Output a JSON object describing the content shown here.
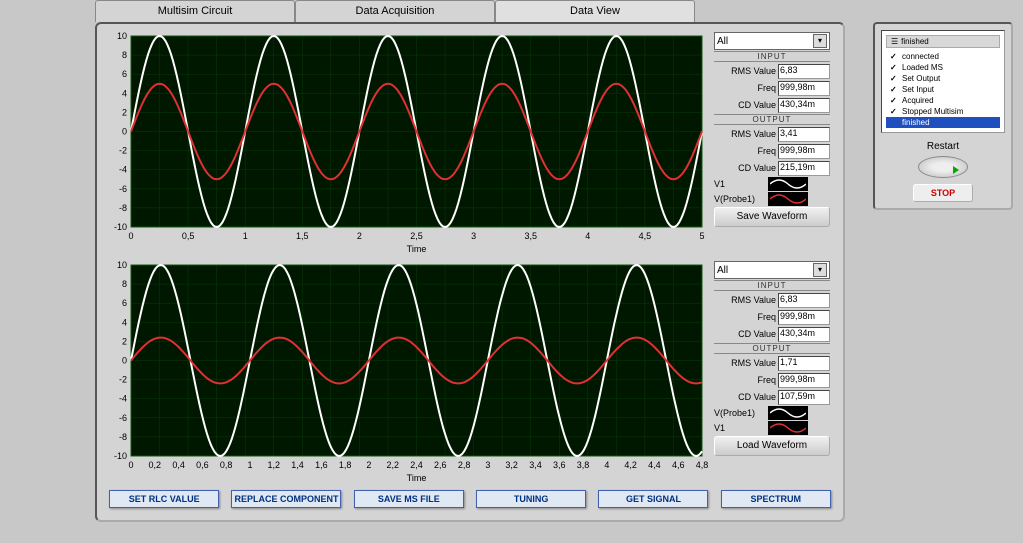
{
  "tabs": {
    "t1": "Multisim Circuit",
    "t2": "Data Acquisition",
    "t3": "Data View"
  },
  "chart1": {
    "y_ticks": [
      10,
      8,
      6,
      4,
      2,
      0,
      -2,
      -4,
      -6,
      -8,
      -10
    ],
    "x_ticks": [
      "0",
      "0,5",
      "1",
      "1,5",
      "2",
      "2,5",
      "3",
      "3,5",
      "4",
      "4,5",
      "5"
    ],
    "xlabel": "Time",
    "dropdown": "All",
    "input_header": "INPUT",
    "output_header": "OUTPUT",
    "input": {
      "rms_l": "RMS Value",
      "rms_v": "6,83",
      "freq_l": "Freq",
      "freq_v": "999,98m",
      "cd_l": "CD Value",
      "cd_v": "430,34m"
    },
    "output": {
      "rms_l": "RMS Value",
      "rms_v": "3,41",
      "freq_l": "Freq",
      "freq_v": "999,98m",
      "cd_l": "CD Value",
      "cd_v": "215,19m"
    },
    "legend1": "V1",
    "legend2": "V(Probe1)",
    "save_btn": "Save Waveform"
  },
  "chart2": {
    "y_ticks": [
      10,
      8,
      6,
      4,
      2,
      0,
      -2,
      -4,
      -6,
      -8,
      -10
    ],
    "x_ticks": [
      "0",
      "0,2",
      "0,4",
      "0,6",
      "0,8",
      "1",
      "1,2",
      "1,4",
      "1,6",
      "1,8",
      "2",
      "2,2",
      "2,4",
      "2,6",
      "2,8",
      "3",
      "3,2",
      "3,4",
      "3,6",
      "3,8",
      "4",
      "4,2",
      "4,4",
      "4,6",
      "4,8"
    ],
    "xlabel": "Time",
    "dropdown": "All",
    "input_header": "INPUT",
    "output_header": "OUTPUT",
    "input": {
      "rms_l": "RMS Value",
      "rms_v": "6,83",
      "freq_l": "Freq",
      "freq_v": "999,98m",
      "cd_l": "CD Value",
      "cd_v": "430,34m"
    },
    "output": {
      "rms_l": "RMS Value",
      "rms_v": "1,71",
      "freq_l": "Freq",
      "freq_v": "999,98m",
      "cd_l": "CD Value",
      "cd_v": "107,59m"
    },
    "legend1": "V(Probe1)",
    "legend2": "V1",
    "load_btn": "Load Waveform"
  },
  "buttons": {
    "b1": "SET RLC VALUE",
    "b2": "REPLACE COMPONENT",
    "b3": "SAVE MS FILE",
    "b4": "TUNING",
    "b5": "GET SIGNAL",
    "b6": "SPECTRUM"
  },
  "status": {
    "header": "finished",
    "items": [
      "connected",
      "Loaded MS",
      "Set Output",
      "Set Input",
      "Acquired",
      "Stopped Multisim"
    ],
    "selected": "finished",
    "restart": "Restart",
    "stop": "STOP"
  },
  "chart_data": [
    {
      "type": "line",
      "title": "",
      "xlabel": "Time",
      "ylabel": "",
      "ylim": [
        -10,
        10
      ],
      "xlim": [
        0,
        5
      ],
      "series": [
        {
          "name": "V1",
          "color": "#ffffff",
          "amplitude": 10,
          "frequency": 1,
          "phase": 0
        },
        {
          "name": "V(Probe1)",
          "color": "#e03030",
          "amplitude": 5,
          "frequency": 1,
          "phase": 0
        }
      ]
    },
    {
      "type": "line",
      "title": "",
      "xlabel": "Time",
      "ylabel": "",
      "ylim": [
        -10,
        10
      ],
      "xlim": [
        0,
        4.8
      ],
      "series": [
        {
          "name": "V(Probe1)",
          "color": "#ffffff",
          "amplitude": 10,
          "frequency": 1,
          "phase": 0
        },
        {
          "name": "V1",
          "color": "#e03030",
          "amplitude": 2.4,
          "frequency": 1,
          "phase": 0
        }
      ]
    }
  ]
}
